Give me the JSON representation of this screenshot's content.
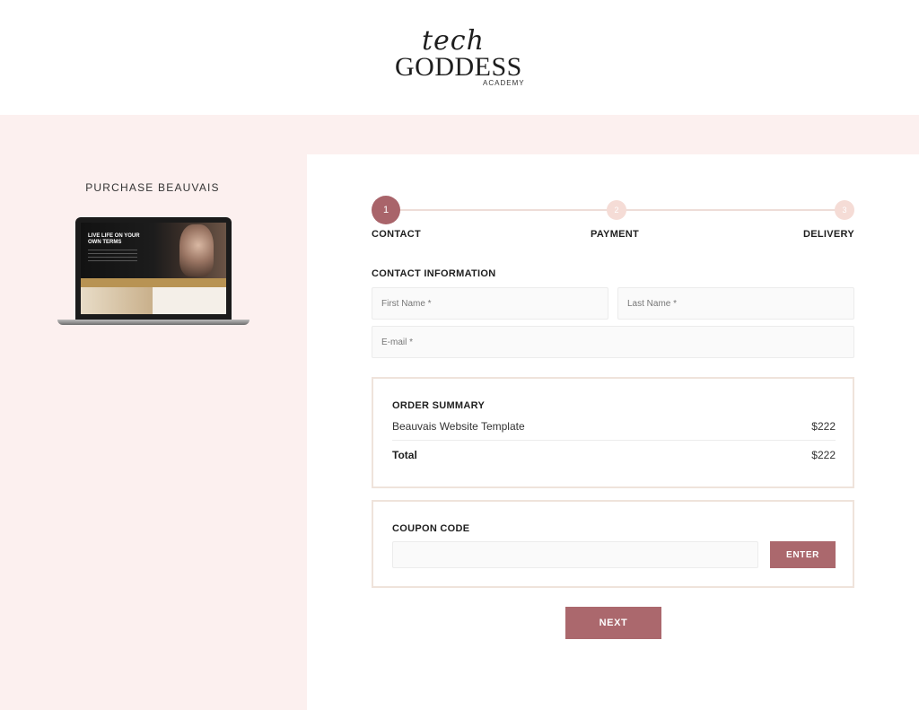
{
  "header": {
    "logo_script": "tech",
    "logo_main": "GODDESS",
    "logo_sub": "ACADEMY"
  },
  "product": {
    "title": "PURCHASE BEAUVAIS",
    "screen_headline": "LIVE LIFE ON YOUR OWN TERMS"
  },
  "steps": [
    {
      "number": "1",
      "label": "CONTACT"
    },
    {
      "number": "2",
      "label": "PAYMENT"
    },
    {
      "number": "3",
      "label": "DELIVERY"
    }
  ],
  "contact": {
    "heading": "CONTACT INFORMATION",
    "first_name_placeholder": "First Name *",
    "last_name_placeholder": "Last Name *",
    "email_placeholder": "E-mail *"
  },
  "order_summary": {
    "heading": "ORDER SUMMARY",
    "item_name": "Beauvais Website Template",
    "item_price": "$222",
    "total_label": "Total",
    "total_price": "$222"
  },
  "coupon": {
    "heading": "COUPON CODE",
    "enter_label": "ENTER"
  },
  "next_label": "NEXT",
  "colors": {
    "accent": "#ab686d",
    "page_pink": "#fcf0ef",
    "step_inactive": "#f5dcd6"
  }
}
